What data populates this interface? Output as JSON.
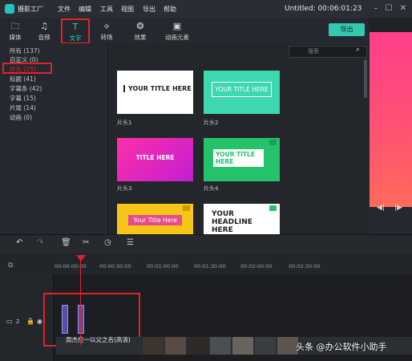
{
  "app": {
    "name": "摄影工厂",
    "project_title": "Untitled: 00:06:01:23"
  },
  "menu": [
    "文件",
    "编辑",
    "工具",
    "视图",
    "导出",
    "帮助"
  ],
  "tabs": [
    {
      "label": "媒体",
      "icon": "folder-icon"
    },
    {
      "label": "音频",
      "icon": "music-note-icon"
    },
    {
      "label": "文字",
      "icon": "text-t-icon",
      "active": true
    },
    {
      "label": "转场",
      "icon": "transition-icon"
    },
    {
      "label": "效果",
      "icon": "effects-icon"
    },
    {
      "label": "动画元素",
      "icon": "image-icon"
    }
  ],
  "export_label": "导出",
  "categories": [
    "所有 (137)",
    "自定义 (0)",
    "片头 (25)",
    "标题 (41)",
    "字幕条 (42)",
    "字幕 (15)",
    "片尾 (14)",
    "动画 (0)"
  ],
  "selected_category": "片头 (25)",
  "search": {
    "placeholder": "搜索"
  },
  "thumbnails": [
    {
      "caption": "片头1",
      "text": "YOUR TITLE HERE"
    },
    {
      "caption": "片头2",
      "text": "YOUR TITLE HERE"
    },
    {
      "caption": "片头3",
      "text": "TITLE HERE"
    },
    {
      "caption": "片头4",
      "text": "YOUR TITLE HERE"
    },
    {
      "caption": "",
      "text": "Your Title Here"
    },
    {
      "caption": "",
      "text": "YOUR HEADLINE HERE"
    }
  ],
  "timeline": {
    "ticks": [
      "00:00:00:00",
      "00:00:30:00",
      "00:01:00:00",
      "00:01:30:00",
      "00:02:00:00",
      "00:02:30:00"
    ],
    "track_number": "2",
    "clip_title": "周杰伦一以父之名(高清)"
  },
  "watermark": "头条 @办公软件小助手",
  "colors": {
    "accent": "#2fd0c3",
    "highlight": "#e0232b",
    "export": "#33c9b0"
  }
}
